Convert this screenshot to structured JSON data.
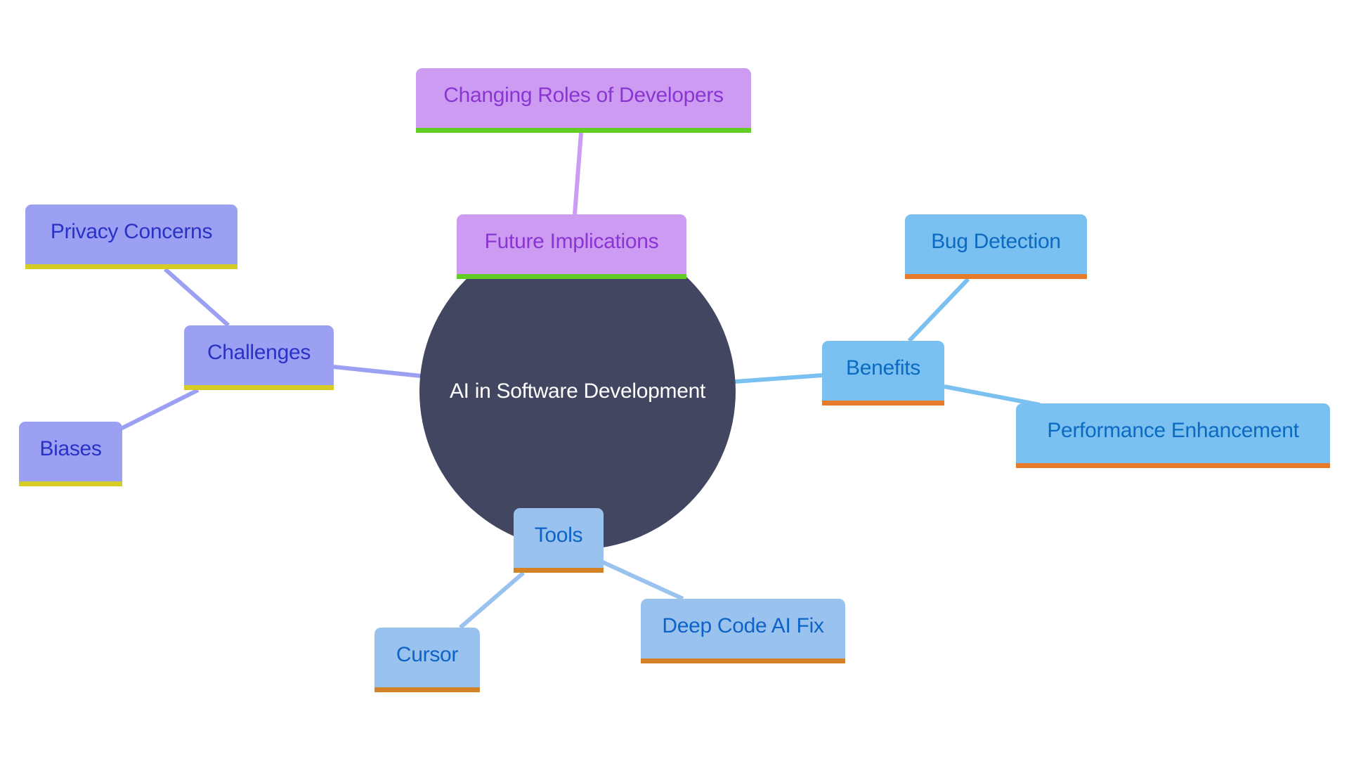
{
  "diagram": {
    "type": "mindmap",
    "root": {
      "label": "AI in Software Development",
      "color": "#424660"
    },
    "branches": [
      {
        "id": "future",
        "label": "Future Implications",
        "color": "#cd9cf2",
        "accent": "#62cd22",
        "children": [
          {
            "id": "roles",
            "label": "Changing Roles of Developers"
          }
        ]
      },
      {
        "id": "challenges",
        "label": "Challenges",
        "color": "#9ba0f2",
        "accent": "#d6cc26",
        "children": [
          {
            "id": "privacy",
            "label": "Privacy Concerns"
          },
          {
            "id": "biases",
            "label": "Biases"
          }
        ]
      },
      {
        "id": "benefits",
        "label": "Benefits",
        "color": "#7ac0f0",
        "accent": "#e67b2c",
        "children": [
          {
            "id": "bug",
            "label": "Bug Detection"
          },
          {
            "id": "perf",
            "label": "Performance Enhancement"
          }
        ]
      },
      {
        "id": "tools",
        "label": "Tools",
        "color": "#9ac2ee",
        "accent": "#d48226",
        "children": [
          {
            "id": "cursor",
            "label": "Cursor"
          },
          {
            "id": "deepcode",
            "label": "Deep Code AI Fix"
          }
        ]
      }
    ]
  }
}
